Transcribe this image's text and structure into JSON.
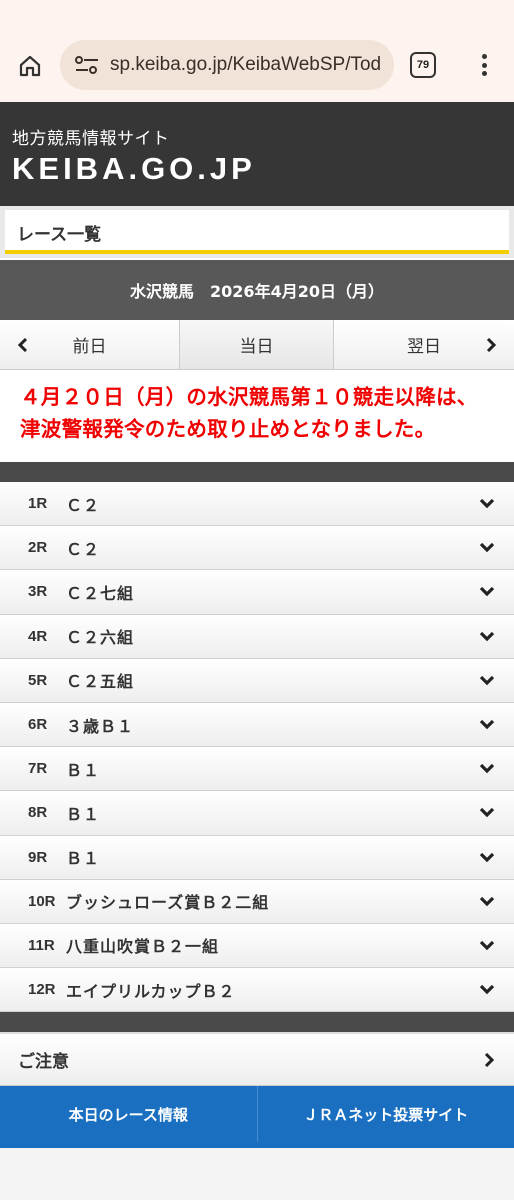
{
  "browser": {
    "url": "sp.keiba.go.jp/KeibaWebSP/Tod",
    "tab_count": "79"
  },
  "site": {
    "subtitle": "地方競馬情報サイト",
    "logo": "KEIBA.GO.JP"
  },
  "page_title": "レース一覧",
  "date_bar": "水沢競馬　2026年4月20日（月）",
  "day_nav": {
    "prev": "前日",
    "today": "当日",
    "next": "翌日"
  },
  "notice": {
    "line1": "４月２０日（月）の水沢競馬第１０競走以降は、",
    "line2": "津波警報発令のため取り止めとなりました。"
  },
  "races": [
    {
      "no": "1R",
      "name": "Ｃ２"
    },
    {
      "no": "2R",
      "name": "Ｃ２"
    },
    {
      "no": "3R",
      "name": "Ｃ２七組"
    },
    {
      "no": "4R",
      "name": "Ｃ２六組"
    },
    {
      "no": "5R",
      "name": "Ｃ２五組"
    },
    {
      "no": "6R",
      "name": "３歳Ｂ１"
    },
    {
      "no": "7R",
      "name": "Ｂ１"
    },
    {
      "no": "8R",
      "name": "Ｂ１"
    },
    {
      "no": "9R",
      "name": "Ｂ１"
    },
    {
      "no": "10R",
      "name": "ブッシュローズ賞Ｂ２二組"
    },
    {
      "no": "11R",
      "name": "八重山吹賞Ｂ２一組"
    },
    {
      "no": "12R",
      "name": "エイプリルカップＢ２"
    }
  ],
  "caution": "ご注意",
  "bottom_buttons": {
    "left": "本日のレース情報",
    "right": "ＪＲＡネット投票サイト"
  },
  "colors": {
    "header_bg": "#363636",
    "accent_yellow": "#f3cf00",
    "notice_red": "#f00000",
    "button_blue": "#1a6fc0"
  }
}
